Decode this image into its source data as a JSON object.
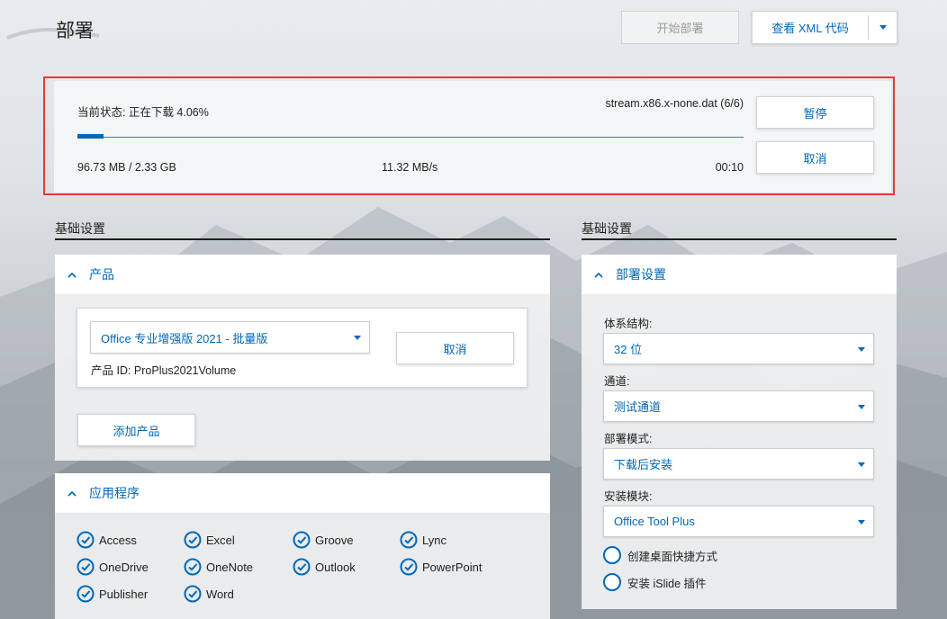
{
  "page": {
    "title": "部署"
  },
  "toolbar": {
    "start_deploy": "开始部署",
    "view_xml": "查看 XML 代码"
  },
  "status": {
    "state_text": "当前状态: 正在下载  4.06%",
    "file": "stream.x86.x-none.dat (6/6)",
    "progress_fraction": 0.0406,
    "size": "96.73 MB / 2.33 GB",
    "speed": "11.32 MB/s",
    "time": "00:10",
    "pause": "暂停",
    "cancel": "取消"
  },
  "left_section": {
    "label": "基础设置",
    "product_card": {
      "title": "产品",
      "selected_product": "Office 专业增强版 2021 - 批量版",
      "product_id": "产品 ID: ProPlus2021Volume",
      "cancel": "取消",
      "add_product": "添加产品"
    },
    "apps_card": {
      "title": "应用程序",
      "apps": [
        "Access",
        "Excel",
        "Groove",
        "Lync",
        "OneDrive",
        "OneNote",
        "Outlook",
        "PowerPoint",
        "Publisher",
        "Word"
      ]
    }
  },
  "right_section": {
    "label": "基础设置",
    "deploy_card": {
      "title": "部署设置",
      "arch_label": "体系结构:",
      "arch_value": "32 位",
      "channel_label": "通道:",
      "channel_value": "测试通道",
      "mode_label": "部署模式:",
      "mode_value": "下载后安装",
      "module_label": "安装模块:",
      "module_value": "Office Tool Plus",
      "option_shortcut": "创建桌面快捷方式",
      "option_islide": "安装 iSlide 插件"
    }
  },
  "colors": {
    "accent": "#0067b8",
    "highlight_border": "#e03b3b"
  },
  "icons": {
    "collapse": "chevron-up-icon",
    "checkbox": "checkmark-circle-icon",
    "dropdown": "caret-down-icon"
  }
}
